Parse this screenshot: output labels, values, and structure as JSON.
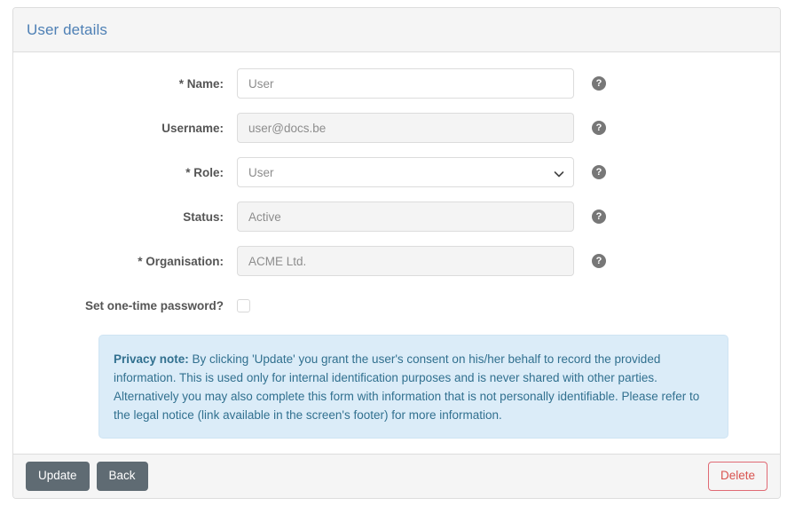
{
  "panel": {
    "title": "User details"
  },
  "form": {
    "rows": [
      {
        "label": "* Name:",
        "value": "User",
        "type": "text",
        "disabled": false,
        "help": "?",
        "name": "name"
      },
      {
        "label": "Username:",
        "value": "user@docs.be",
        "type": "text",
        "disabled": true,
        "help": "?",
        "name": "username"
      },
      {
        "label": "* Role:",
        "value": "User",
        "type": "select",
        "disabled": false,
        "help": "?",
        "name": "role",
        "options": [
          "User"
        ]
      },
      {
        "label": "Status:",
        "value": "Active",
        "type": "text",
        "disabled": true,
        "help": "?",
        "name": "status"
      },
      {
        "label": "* Organisation:",
        "value": "ACME Ltd.",
        "type": "text",
        "disabled": true,
        "help": "?",
        "name": "organisation"
      }
    ],
    "one_time_password": {
      "label": "Set one-time password?",
      "checked": false
    }
  },
  "privacy_note": {
    "heading": "Privacy note:",
    "text": " By clicking 'Update' you grant the user's consent on his/her behalf to record the provided information. This is used only for internal identification purposes and is never shared with other parties. Alternatively you may also complete this form with information that is not personally identifiable. Please refer to the legal notice (link available in the screen's footer) for more information."
  },
  "footer": {
    "update_label": "Update",
    "back_label": "Back",
    "delete_label": "Delete"
  },
  "colors": {
    "title": "#4e80b5",
    "note_bg": "#dbecf8",
    "note_text": "#31708f",
    "button_default": "#5f6b73",
    "delete": "#d9534f"
  }
}
